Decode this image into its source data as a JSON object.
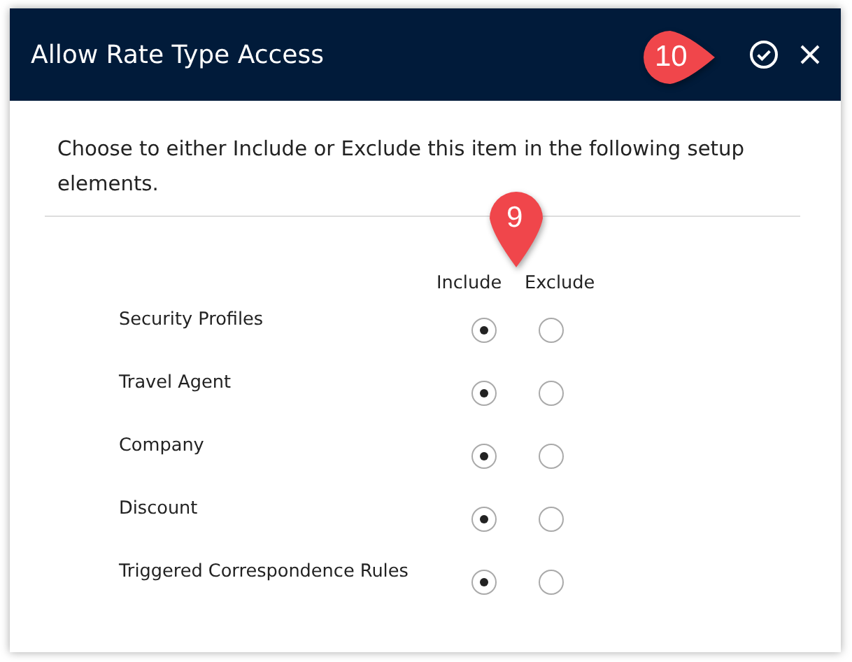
{
  "dialog": {
    "title": "Allow Rate Type Access",
    "description": "Choose to either Include or Exclude this item in the following setup elements."
  },
  "callouts": [
    {
      "kind": "right",
      "label": "10"
    },
    {
      "kind": "down",
      "label": "9"
    }
  ],
  "columns": [
    "Include",
    "Exclude"
  ],
  "rows": [
    {
      "label": "Security Profiles",
      "options": [
        {
          "selected": true
        },
        {
          "selected": false
        }
      ]
    },
    {
      "label": "Travel Agent",
      "options": [
        {
          "selected": true
        },
        {
          "selected": false
        }
      ]
    },
    {
      "label": "Company",
      "options": [
        {
          "selected": true
        },
        {
          "selected": false
        }
      ]
    },
    {
      "label": "Discount",
      "options": [
        {
          "selected": true
        },
        {
          "selected": false
        }
      ]
    },
    {
      "label": "Triggered Correspondence Rules",
      "options": [
        {
          "selected": true
        },
        {
          "selected": false
        }
      ]
    }
  ]
}
